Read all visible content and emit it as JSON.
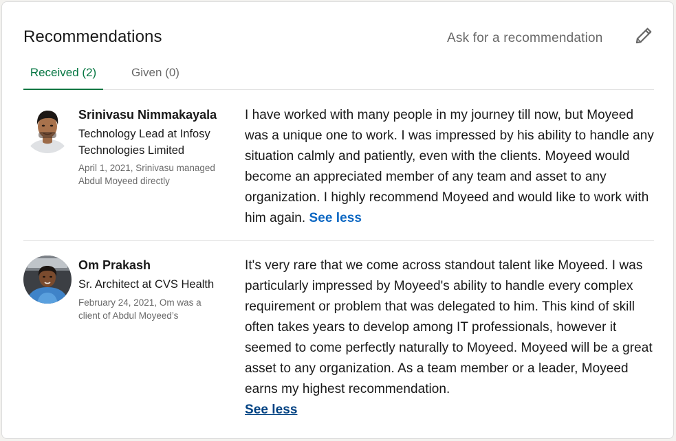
{
  "section": {
    "title": "Recommendations",
    "ask_label": "Ask for a recommendation",
    "edit_icon": "pencil-icon"
  },
  "tabs": [
    {
      "label": "Received (2)",
      "active": true
    },
    {
      "label": "Given (0)",
      "active": false
    }
  ],
  "recommendations": [
    {
      "name": "Srinivasu Nimmakayala",
      "headline": "Technology Lead at Infosy Technologies Limited",
      "meta": "April 1, 2021, Srinivasu managed Abdul Moyeed directly",
      "text": "I have worked with many people in my journey till now, but Moyeed was a unique one to work. I was impressed by his ability to handle any situation calmly and patiently, even with the clients. Moyeed would become an appreciated member of any team and asset to any organization. I highly recommend Moyeed and would like to work with him again.",
      "toggle_label": "See less"
    },
    {
      "name": "Om Prakash",
      "headline": "Sr. Architect at CVS Health",
      "meta": "February 24, 2021, Om was a client of Abdul Moyeed’s",
      "text": "It's very rare that we come across standout talent like Moyeed. I was particularly impressed by Moyeed's ability to handle every complex requirement or problem that was delegated to him. This kind of skill often takes years to develop among IT professionals, however it seemed to come perfectly naturally to Moyeed. Moyeed will be a great asset to any organization. As a team member or a leader, Moyeed earns my highest recommendation.",
      "toggle_label": "See less"
    }
  ],
  "colors": {
    "accent_green": "#057642",
    "link_blue": "#0a66c2",
    "link_dark_blue": "#004182"
  }
}
